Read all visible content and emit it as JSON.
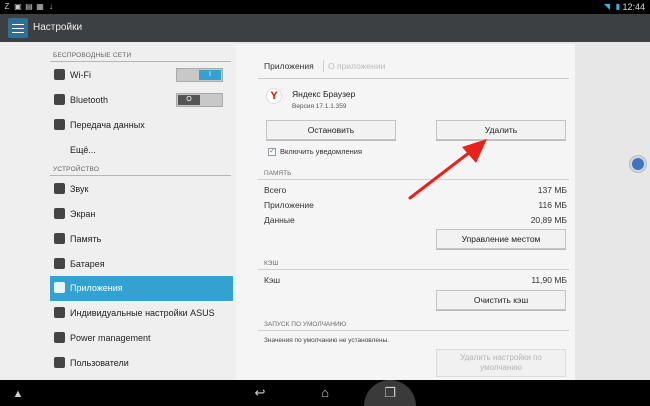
{
  "status_bar": {
    "time": "12:44"
  },
  "action_bar": {
    "title": "Настройки"
  },
  "sidebar": {
    "section_wireless": "БЕСПРОВОДНЫЕ СЕТИ",
    "wifi_label": "Wi-Fi",
    "wifi_toggle": "I",
    "bluetooth_label": "Bluetooth",
    "bluetooth_toggle": "O",
    "data_transfer_label": "Передача данных",
    "more_label": "Ещё...",
    "section_device": "УСТРОЙСТВО",
    "sound_label": "Звук",
    "screen_label": "Экран",
    "memory_label": "Память",
    "battery_label": "Батарея",
    "apps_label": "Приложения",
    "asus_label": "Индивидуальные настройки ASUS",
    "power_label": "Power management",
    "users_label": "Пользователи"
  },
  "tabs": {
    "apps": "Приложения",
    "about": "О приложении"
  },
  "app_info": {
    "name": "Яндекс Браузер",
    "version": "Версия 17.1.1.359",
    "icon_letter": "Y"
  },
  "buttons": {
    "stop": "Остановить",
    "delete": "Удалить",
    "manage_storage": "Управление местом",
    "clear_cache": "Очистить кэш",
    "clear_defaults": "Удалить настройки по умолчанию"
  },
  "notifications": {
    "label": "Включить уведомления",
    "checked": true
  },
  "storage": {
    "heading": "ПАМЯТЬ",
    "total_label": "Всего",
    "total_value": "137 МБ",
    "app_label": "Приложение",
    "app_value": "116 МБ",
    "data_label": "Данные",
    "data_value": "20,89 МБ"
  },
  "cache": {
    "heading": "КЭШ",
    "label": "Кэш",
    "value": "11,90 МБ"
  },
  "defaults": {
    "heading": "ЗАПУСК ПО УМОЛЧАНИЮ",
    "text": "Значения по умолчанию не установлены."
  },
  "colors": {
    "accent": "#33a2d0",
    "arrow": "#e8221b"
  }
}
